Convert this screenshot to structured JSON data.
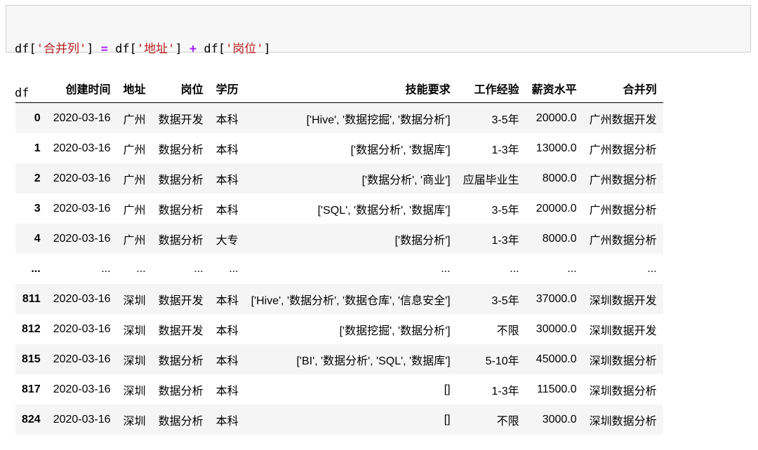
{
  "code": {
    "line1": [
      {
        "t": "df[",
        "k": "plain"
      },
      {
        "t": "'合并列'",
        "k": "str"
      },
      {
        "t": "] ",
        "k": "plain"
      },
      {
        "t": "=",
        "k": "op"
      },
      {
        "t": " df[",
        "k": "plain"
      },
      {
        "t": "'地址'",
        "k": "str"
      },
      {
        "t": "] ",
        "k": "plain"
      },
      {
        "t": "+",
        "k": "op"
      },
      {
        "t": " df[",
        "k": "plain"
      },
      {
        "t": "'岗位'",
        "k": "str"
      },
      {
        "t": "]",
        "k": "plain"
      }
    ],
    "line2": "df"
  },
  "table": {
    "columns": [
      "",
      "创建时间",
      "地址",
      "岗位",
      "学历",
      "技能要求",
      "工作经验",
      "薪资水平",
      "合并列"
    ],
    "rows": [
      [
        "0",
        "2020-03-16",
        "广州",
        "数据开发",
        "本科",
        "['Hive', '数据挖掘', '数据分析']",
        "3-5年",
        "20000.0",
        "广州数据开发"
      ],
      [
        "1",
        "2020-03-16",
        "广州",
        "数据分析",
        "本科",
        "['数据分析', '数据库']",
        "1-3年",
        "13000.0",
        "广州数据分析"
      ],
      [
        "2",
        "2020-03-16",
        "广州",
        "数据分析",
        "本科",
        "['数据分析', '商业']",
        "应届毕业生",
        "8000.0",
        "广州数据分析"
      ],
      [
        "3",
        "2020-03-16",
        "广州",
        "数据分析",
        "本科",
        "['SQL', '数据分析', '数据库']",
        "3-5年",
        "20000.0",
        "广州数据分析"
      ],
      [
        "4",
        "2020-03-16",
        "广州",
        "数据分析",
        "大专",
        "['数据分析']",
        "1-3年",
        "8000.0",
        "广州数据分析"
      ],
      [
        "...",
        "...",
        "...",
        "...",
        "...",
        "...",
        "...",
        "...",
        "..."
      ],
      [
        "811",
        "2020-03-16",
        "深圳",
        "数据开发",
        "本科",
        "['Hive', '数据分析', '数据仓库', '信息安全']",
        "3-5年",
        "37000.0",
        "深圳数据开发"
      ],
      [
        "812",
        "2020-03-16",
        "深圳",
        "数据开发",
        "本科",
        "['数据挖掘', '数据分析']",
        "不限",
        "30000.0",
        "深圳数据开发"
      ],
      [
        "815",
        "2020-03-16",
        "深圳",
        "数据分析",
        "本科",
        "['BI', '数据分析', 'SQL', '数据库']",
        "5-10年",
        "45000.0",
        "深圳数据分析"
      ],
      [
        "817",
        "2020-03-16",
        "深圳",
        "数据分析",
        "本科",
        "[]",
        "1-3年",
        "11500.0",
        "深圳数据分析"
      ],
      [
        "824",
        "2020-03-16",
        "深圳",
        "数据分析",
        "本科",
        "[]",
        "不限",
        "3000.0",
        "深圳数据分析"
      ]
    ]
  }
}
